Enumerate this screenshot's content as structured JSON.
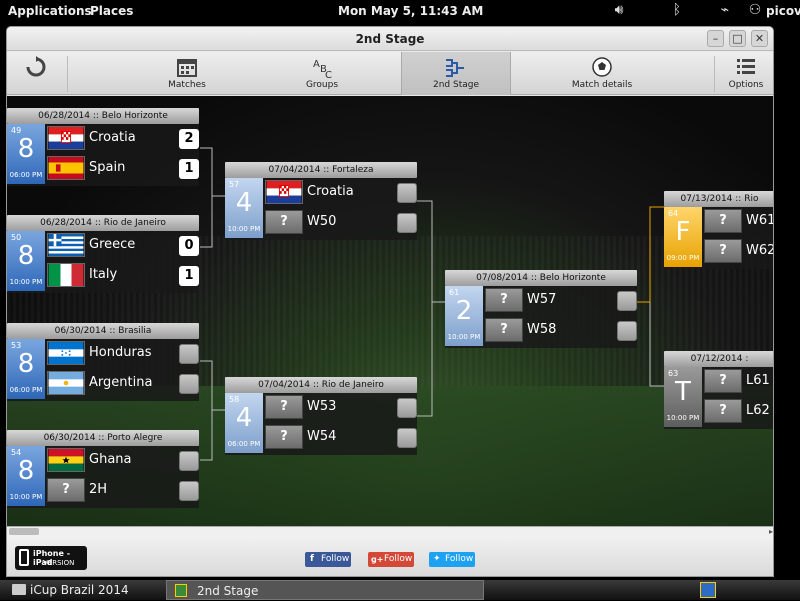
{
  "top_panel": {
    "applications": "Applications",
    "places": "Places",
    "clock": "Mon May  5, 11:43 AM",
    "user": "picov",
    "tray_icons": [
      "volume-icon",
      "bluetooth-icon",
      "network-icon"
    ]
  },
  "window": {
    "title": "2nd Stage",
    "controls": [
      "minimize",
      "maximize",
      "close"
    ]
  },
  "toolbar": {
    "refresh_icon": "refresh-icon",
    "items": [
      {
        "label": "Matches",
        "icon": "calendar-icon",
        "active": false
      },
      {
        "label": "Groups",
        "icon": "abc-icon",
        "active": false
      },
      {
        "label": "2nd Stage",
        "icon": "bracket-icon",
        "active": true
      },
      {
        "label": "Match details",
        "icon": "soccer-ball-icon",
        "active": false
      },
      {
        "label": "Options",
        "icon": "list-icon",
        "active": false
      }
    ]
  },
  "bracket": {
    "round_of_16": [
      {
        "header": "06/28/2014 :: Belo Horizonte",
        "match_no": "49",
        "day": "8",
        "time": "06:00 PM",
        "teams": [
          {
            "name": "Croatia",
            "flag": "croatia",
            "score": "2"
          },
          {
            "name": "Spain",
            "flag": "spain",
            "score": "1"
          }
        ]
      },
      {
        "header": "06/28/2014 :: Rio de Janeiro",
        "match_no": "50",
        "day": "8",
        "time": "10:00 PM",
        "teams": [
          {
            "name": "Greece",
            "flag": "greece",
            "score": "0"
          },
          {
            "name": "Italy",
            "flag": "italy",
            "score": "1"
          }
        ]
      },
      {
        "header": "06/30/2014 :: Brasilia",
        "match_no": "53",
        "day": "8",
        "time": "06:00 PM",
        "teams": [
          {
            "name": "Honduras",
            "flag": "honduras",
            "score": ""
          },
          {
            "name": "Argentina",
            "flag": "argentina",
            "score": ""
          }
        ]
      },
      {
        "header": "06/30/2014 :: Porto Alegre",
        "match_no": "54",
        "day": "8",
        "time": "10:00 PM",
        "teams": [
          {
            "name": "Ghana",
            "flag": "ghana",
            "score": ""
          },
          {
            "name": "2H",
            "flag": "unknown",
            "score": ""
          }
        ]
      }
    ],
    "quarter_finals": [
      {
        "header": "07/04/2014 :: Fortaleza",
        "match_no": "57",
        "day": "4",
        "time": "10:00 PM",
        "teams": [
          {
            "name": "Croatia",
            "flag": "croatia",
            "score": ""
          },
          {
            "name": "W50",
            "flag": "unknown",
            "score": ""
          }
        ]
      },
      {
        "header": "07/04/2014 :: Rio de Janeiro",
        "match_no": "58",
        "day": "4",
        "time": "06:00 PM",
        "teams": [
          {
            "name": "W53",
            "flag": "unknown",
            "score": ""
          },
          {
            "name": "W54",
            "flag": "unknown",
            "score": ""
          }
        ]
      }
    ],
    "semi_final": {
      "header": "07/08/2014 :: Belo Horizonte",
      "match_no": "61",
      "day": "2",
      "time": "10:00 PM",
      "teams": [
        {
          "name": "W57",
          "flag": "unknown",
          "score": ""
        },
        {
          "name": "W58",
          "flag": "unknown",
          "score": ""
        }
      ]
    },
    "final": {
      "header": "07/13/2014 :: Rio",
      "match_no": "64",
      "day": "F",
      "time": "09:00 PM",
      "teams": [
        {
          "name": "W61",
          "flag": "unknown",
          "score": ""
        },
        {
          "name": "W62",
          "flag": "unknown",
          "score": ""
        }
      ]
    },
    "third_place": {
      "header": "07/12/2014 :",
      "match_no": "63",
      "day": "T",
      "time": "10:00 PM",
      "teams": [
        {
          "name": "L61",
          "flag": "unknown",
          "score": ""
        },
        {
          "name": "L62",
          "flag": "unknown",
          "score": ""
        }
      ]
    }
  },
  "footer": {
    "badge_line1": "iPhone - iPad",
    "badge_line2": "VERSION",
    "follow": [
      {
        "label": "Follow",
        "network": "facebook",
        "color": "#3b5998"
      },
      {
        "label": "Follow",
        "network": "google-plus",
        "color": "#d34836"
      },
      {
        "label": "Follow",
        "network": "twitter",
        "color": "#1da1f2"
      }
    ]
  },
  "taskbar": {
    "items": [
      {
        "label": "iCup Brazil 2014",
        "active": false
      },
      {
        "label": "2nd Stage",
        "active": true
      }
    ]
  }
}
